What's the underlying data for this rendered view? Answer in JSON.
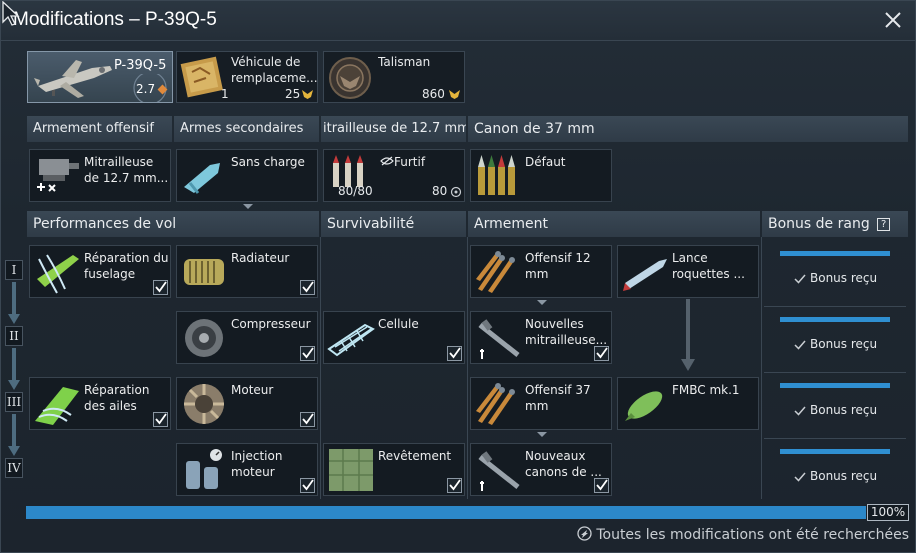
{
  "window": {
    "title": "Modifications – P-39Q-5",
    "close_icon": "close-icon"
  },
  "top": {
    "aircraft": {
      "name": "P-39Q-5",
      "rank": "2.7"
    },
    "backup": {
      "label": "Véhicule de remplaceme...",
      "count": "1",
      "price": "25"
    },
    "talisman": {
      "label": "Talisman",
      "price": "860"
    }
  },
  "weapon_headers": [
    "Armement offensif",
    "Armes secondaires",
    "itrailleuse de 12.7 mm",
    "Canon de 37 mm"
  ],
  "weapons": {
    "offensive": {
      "label": "Mitrailleuse de 12.7 mm..."
    },
    "secondary": {
      "label": "Sans charge"
    },
    "mg_belt": {
      "label": "Furtif",
      "ammo": "80/80",
      "count": "80"
    },
    "cannon_belt": {
      "label": "Défaut"
    }
  },
  "section_headers": {
    "flight": "Performances de vol",
    "survivability": "Survivabilité",
    "armament": "Armement",
    "rank_bonus": "Bonus de rang",
    "rank_help": "?"
  },
  "tiers": [
    "I",
    "II",
    "III",
    "IV"
  ],
  "mods": {
    "fuselage": "Réparation du fuselage",
    "radiator": "Radiateur",
    "compressor": "Compresseur",
    "wings": "Réparation des ailes",
    "engine": "Moteur",
    "injection": "Injection moteur",
    "airframe": "Cellule",
    "cover": "Revêtement",
    "off12": "Offensif 12 mm",
    "rockets": "Lance roquettes ...",
    "new_mg": "Nouvelles mitrailleuse...",
    "off37": "Offensif 37 mm",
    "fmbc": "FMBC mk.1",
    "new_cannon": "Nouveaux canons de ..."
  },
  "bonus": [
    "Bonus reçu",
    "Bonus reçu",
    "Bonus reçu",
    "Bonus reçu"
  ],
  "progress": {
    "value": 1.0,
    "label": "100%"
  },
  "footer": "Toutes les modifications ont été recherchées",
  "colors": {
    "accent": "#2c88c9",
    "gold": "#e4b53c",
    "rank": "#e08a3c"
  }
}
